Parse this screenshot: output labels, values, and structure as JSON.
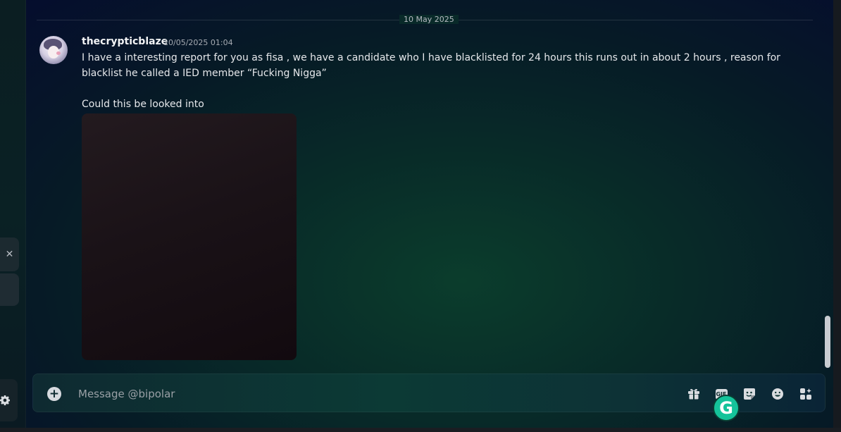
{
  "divider": {
    "date": "10 May 2025"
  },
  "message": {
    "username": "thecrypticblaze",
    "timestamp": "10/05/2025 01:04",
    "text": "I have a interesting report for you as fisa , we have a candidate who I have blacklisted for 24 hours this runs out in about 2 hours , reason for blacklist he called a IED member “Fucking Nigga”\n\nCould this be looked into"
  },
  "composer": {
    "placeholder": "Message @bipolar",
    "value": "",
    "gif_label": "GIF"
  },
  "icons": {
    "close": "close-icon",
    "settings": "gear-icon",
    "add": "plus-circle-icon",
    "gift": "gift-icon",
    "gif": "gif-icon",
    "sticker": "sticker-icon",
    "emoji": "emoji-icon",
    "apps": "apps-icon",
    "grammarly": "grammarly-icon"
  },
  "grammarly": {
    "letter": "G"
  },
  "colors": {
    "accent_grammarly": "#15c39a",
    "text_primary": "#e6e8eb",
    "text_muted": "#a6abb2"
  }
}
